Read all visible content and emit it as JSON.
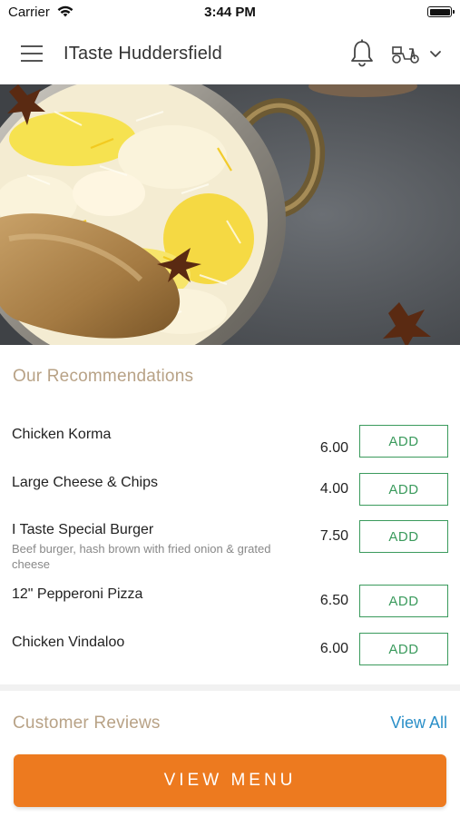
{
  "status_bar": {
    "carrier": "Carrier",
    "time": "3:44 PM"
  },
  "header": {
    "title": "ITaste Huddersfield",
    "icons": [
      "hamburger-menu-icon",
      "bell-icon",
      "scooter-icon",
      "chevron-down-icon"
    ]
  },
  "hero": {
    "image": "biryani-dish-photo"
  },
  "recommendations": {
    "title": "Our Recommendations",
    "add_label": "ADD",
    "items": [
      {
        "name": "Chicken Korma",
        "description": "",
        "price": "6.00"
      },
      {
        "name": "Large Cheese & Chips",
        "description": "",
        "price": "4.00"
      },
      {
        "name": "I Taste Special Burger",
        "description": "Beef burger, hash brown with fried onion & grated cheese",
        "price": "7.50"
      },
      {
        "name": "12\" Pepperoni Pizza",
        "description": "",
        "price": "6.50"
      },
      {
        "name": "Chicken Vindaloo",
        "description": "",
        "price": "6.00"
      }
    ]
  },
  "reviews": {
    "title": "Customer Reviews",
    "view_all_label": "View All"
  },
  "cta": {
    "view_menu_label": "VIEW MENU"
  },
  "colors": {
    "accent_orange": "#ed7a1f",
    "add_green": "#3a9a5c",
    "section_title_tan": "#b8a286",
    "link_blue": "#2a8fc8"
  }
}
